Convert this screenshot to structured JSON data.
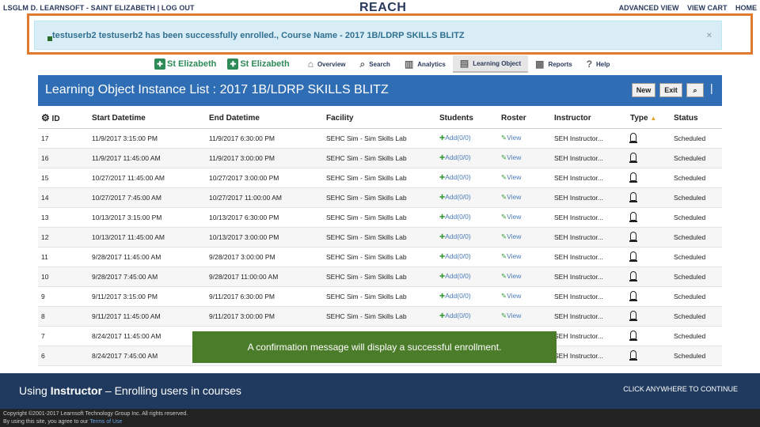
{
  "topbar": {
    "user": "LSGLM D. LEARNSOFT - SAINT ELIZABETH",
    "logout": "LOG OUT",
    "brand": "REACH",
    "links": [
      "ADVANCED VIEW",
      "VIEW CART",
      "HOME"
    ]
  },
  "alert": {
    "message": "testuserb2 testuserb2 has been successfully enrolled., Course Name - 2017 1B/LDRP SKILLS BLITZ",
    "close": "×"
  },
  "nav": {
    "logo1": "St Elizabeth",
    "logo2": "St Elizabeth",
    "items": [
      "Overview",
      "Search",
      "Analytics",
      "Learning Object",
      "Reports",
      "Help"
    ]
  },
  "panel": {
    "title": "Learning Object Instance List : 2017 1B/LDRP SKILLS BLITZ",
    "new_label": "New",
    "exit_label": "Exit",
    "sep": "|"
  },
  "table": {
    "columns": [
      "ID",
      "Start Datetime",
      "End Datetime",
      "Facility",
      "Students",
      "Roster",
      "Instructor",
      "Type",
      "Status"
    ],
    "rows": [
      {
        "id": "17",
        "start": "11/9/2017 3:15:00 PM",
        "end": "11/9/2017 6:30:00 PM",
        "facility": "SEHC Sim - Sim Skills Lab",
        "students": "Add(0/0)",
        "roster": "View",
        "instructor": "SEH Instructor...",
        "status": "Scheduled"
      },
      {
        "id": "16",
        "start": "11/9/2017 11:45:00 AM",
        "end": "11/9/2017 3:00:00 PM",
        "facility": "SEHC Sim - Sim Skills Lab",
        "students": "Add(0/0)",
        "roster": "View",
        "instructor": "SEH Instructor...",
        "status": "Scheduled"
      },
      {
        "id": "15",
        "start": "10/27/2017 11:45:00 AM",
        "end": "10/27/2017 3:00:00 PM",
        "facility": "SEHC Sim - Sim Skills Lab",
        "students": "Add(0/0)",
        "roster": "View",
        "instructor": "SEH Instructor...",
        "status": "Scheduled"
      },
      {
        "id": "14",
        "start": "10/27/2017 7:45:00 AM",
        "end": "10/27/2017 11:00:00 AM",
        "facility": "SEHC Sim - Sim Skills Lab",
        "students": "Add(0/0)",
        "roster": "View",
        "instructor": "SEH Instructor...",
        "status": "Scheduled"
      },
      {
        "id": "13",
        "start": "10/13/2017 3:15:00 PM",
        "end": "10/13/2017 6:30:00 PM",
        "facility": "SEHC Sim - Sim Skills Lab",
        "students": "Add(0/0)",
        "roster": "View",
        "instructor": "SEH Instructor...",
        "status": "Scheduled"
      },
      {
        "id": "12",
        "start": "10/13/2017 11:45:00 AM",
        "end": "10/13/2017 3:00:00 PM",
        "facility": "SEHC Sim - Sim Skills Lab",
        "students": "Add(0/0)",
        "roster": "View",
        "instructor": "SEH Instructor...",
        "status": "Scheduled"
      },
      {
        "id": "11",
        "start": "9/28/2017 11:45:00 AM",
        "end": "9/28/2017 3:00:00 PM",
        "facility": "SEHC Sim - Sim Skills Lab",
        "students": "Add(0/0)",
        "roster": "View",
        "instructor": "SEH Instructor...",
        "status": "Scheduled"
      },
      {
        "id": "10",
        "start": "9/28/2017 7:45:00 AM",
        "end": "9/28/2017 11:00:00 AM",
        "facility": "SEHC Sim - Sim Skills Lab",
        "students": "Add(0/0)",
        "roster": "View",
        "instructor": "SEH Instructor...",
        "status": "Scheduled"
      },
      {
        "id": "9",
        "start": "9/11/2017 3:15:00 PM",
        "end": "9/11/2017 6:30:00 PM",
        "facility": "SEHC Sim - Sim Skills Lab",
        "students": "Add(0/0)",
        "roster": "View",
        "instructor": "SEH Instructor...",
        "status": "Scheduled"
      },
      {
        "id": "8",
        "start": "9/11/2017 11:45:00 AM",
        "end": "9/11/2017 3:00:00 PM",
        "facility": "SEHC Sim - Sim Skills Lab",
        "students": "Add(0/0)",
        "roster": "View",
        "instructor": "SEH Instructor...",
        "status": "Scheduled"
      },
      {
        "id": "7",
        "start": "8/24/2017 11:45:00 AM",
        "end": "",
        "facility": "",
        "students": "",
        "roster": "",
        "instructor": "SEH Instructor...",
        "status": "Scheduled"
      },
      {
        "id": "6",
        "start": "8/24/2017 7:45:00 AM",
        "end": "",
        "facility": "",
        "students": "",
        "roster": "",
        "instructor": "SEH Instructor...",
        "status": "Scheduled"
      }
    ]
  },
  "caption": "A confirmation message will display a successful enrollment.",
  "footer": {
    "title_pre": "Using ",
    "title_bold": "Instructor",
    "title_post": " – Enrolling users in courses",
    "continue": "CLICK ANYWHERE TO CONTINUE",
    "copyright": "Copyright ©2001-2017 Learnsoft Technology Group Inc. All rights reserved.",
    "terms_pre": "By using this site, you agree to our ",
    "terms_link": "Terms of Use"
  },
  "colors": {
    "panel": "#2f6db5",
    "highlight": "#e07a2e",
    "caption": "#4a7c2a",
    "footer": "#1f3a5e"
  }
}
